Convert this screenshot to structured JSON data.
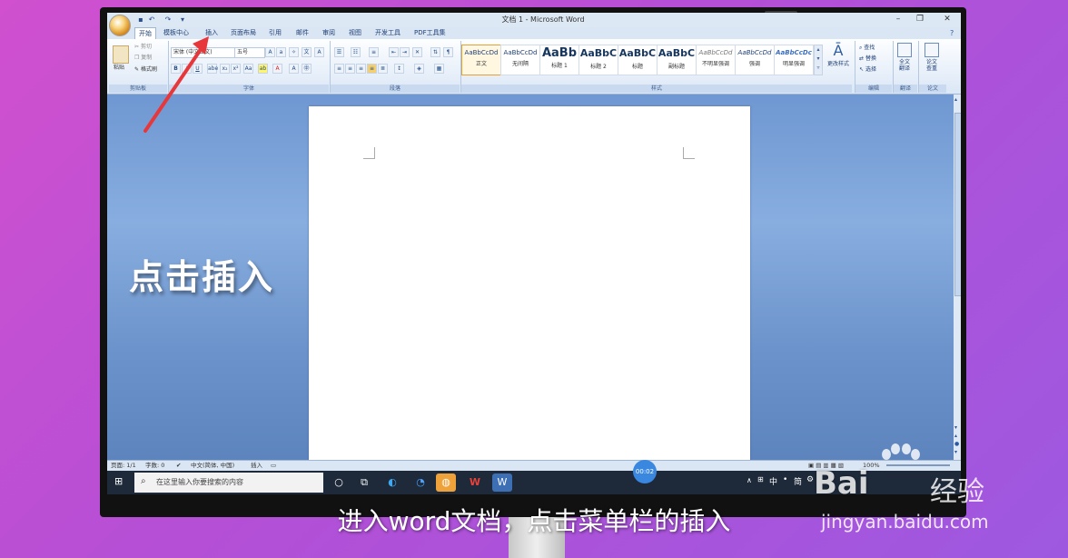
{
  "window": {
    "title": "文档 1 - Microsoft Word"
  },
  "tabs": [
    {
      "label": "开始",
      "active": true
    },
    {
      "label": "模板中心"
    },
    {
      "label": "插入",
      "highlighted": true
    },
    {
      "label": "页面布局"
    },
    {
      "label": "引用"
    },
    {
      "label": "邮件"
    },
    {
      "label": "审阅"
    },
    {
      "label": "视图"
    },
    {
      "label": "开发工具"
    },
    {
      "label": "PDF工具集"
    }
  ],
  "clipboard": {
    "paste": "粘贴",
    "cut": "剪切",
    "copy": "复制",
    "format_painter": "格式刷",
    "label": "剪贴板"
  },
  "font": {
    "name": "宋体 (中文正文)",
    "size": "五号",
    "label": "字体"
  },
  "paragraph": {
    "label": "段落"
  },
  "styles": {
    "label": "样式",
    "items": [
      {
        "sample": "AaBbCcDd",
        "name": "正文"
      },
      {
        "sample": "AaBbCcDd",
        "name": "无间隔"
      },
      {
        "sample": "AaBb",
        "name": "标题 1"
      },
      {
        "sample": "AaBbC",
        "name": "标题 2"
      },
      {
        "sample": "AaBbC",
        "name": "标题"
      },
      {
        "sample": "AaBbC",
        "name": "副标题"
      },
      {
        "sample": "AaBbCcDd",
        "name": "不明显强调"
      },
      {
        "sample": "AaBbCcDd",
        "name": "强调"
      },
      {
        "sample": "AaBbCcDc",
        "name": "明显强调"
      }
    ],
    "change_styles": "更改样式"
  },
  "editing": {
    "find": "查找",
    "replace": "替换",
    "select": "选择",
    "label": "编辑"
  },
  "translate": {
    "full": "全文翻译",
    "label": "翻译"
  },
  "paper": {
    "check": "论文查重",
    "label": "论文"
  },
  "overlay_text": "点击插入",
  "statusbar": {
    "page": "页面: 1/1",
    "words": "字数: 0",
    "language": "中文(简体, 中国)",
    "mode": "插入",
    "zoom": "100%"
  },
  "taskbar": {
    "search_placeholder": "在这里输入你要搜索的内容",
    "ime": "中",
    "ime2": "简"
  },
  "video": {
    "timer": "00:02"
  },
  "caption": "进入word文档，点击菜单栏的插入",
  "watermark": {
    "logo": "Bai",
    "brand": "经验",
    "url": "jingyan.baidu.com"
  },
  "colors": {
    "accent_arrow": "#e8373a",
    "ribbon_blue": "#1e3f74"
  }
}
